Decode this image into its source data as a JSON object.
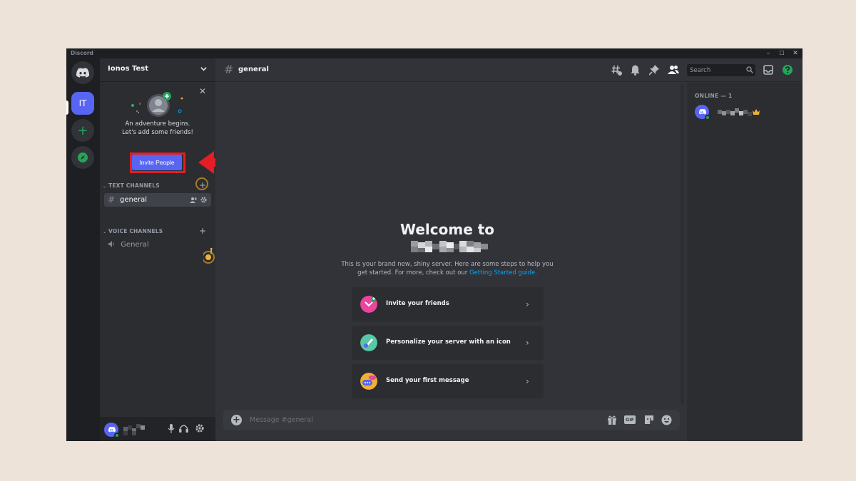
{
  "window": {
    "app_name": "Discord",
    "minimize_glyph": "–",
    "maximize_glyph": "☐",
    "close_glyph": "✕"
  },
  "rail": {
    "server_initials": "IT",
    "add_glyph": "+"
  },
  "sidebar": {
    "server_name": "Ionos Test",
    "onboarding": {
      "line1": "An adventure begins.",
      "line2": "Let's add some friends!",
      "close_glyph": "✕",
      "invite_button": "Invite People"
    },
    "categories": {
      "text": "TEXT CHANNELS",
      "voice": "VOICE CHANNELS",
      "add_glyph": "+"
    },
    "text_channel": {
      "hash": "#",
      "name": "general"
    },
    "voice_channel": {
      "name": "General"
    }
  },
  "main": {
    "hash": "#",
    "channel_title": "general",
    "search_placeholder": "Search",
    "welcome_title": "Welcome to",
    "welcome_desc_prefix": "This is your brand new, shiny server. Here are some steps to help you get started. For more, check out our ",
    "welcome_desc_link": "Getting Started guide.",
    "steps": [
      {
        "label": "Invite your friends"
      },
      {
        "label": "Personalize your server with an icon"
      },
      {
        "label": "Send your first message"
      }
    ],
    "step_chevron": "›",
    "composer_add": "+",
    "composer_placeholder": "Message #general",
    "gif_label": "GIF"
  },
  "members": {
    "online_header": "ONLINE — 1"
  },
  "colors": {
    "blurple": "#5865f2",
    "green": "#23a559",
    "highlight_red": "#e41e24",
    "link": "#00a8fc",
    "page_background": "#ede3d8"
  }
}
